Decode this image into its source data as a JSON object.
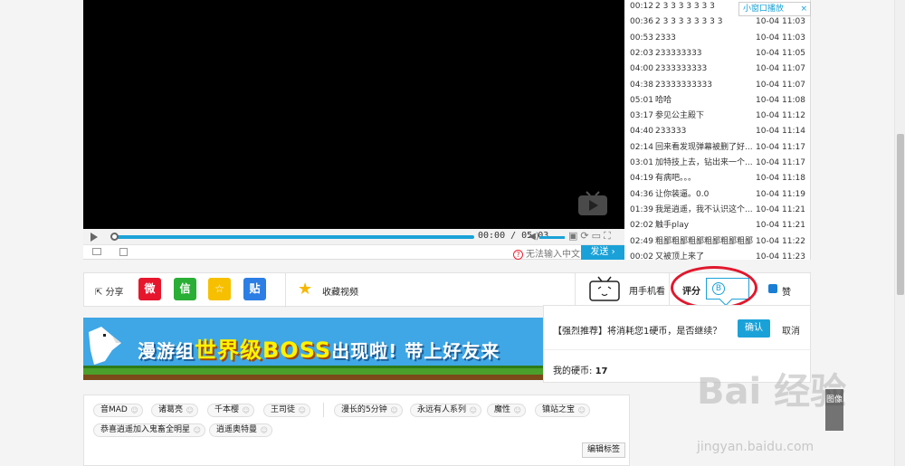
{
  "player": {
    "time_display": "00:00 / 05:03",
    "help_note": "无法输入中文?",
    "send_label": "发送 ›"
  },
  "mini_window": {
    "label": "小窗口播放",
    "close": "×"
  },
  "danmaku": [
    {
      "time": "00:12",
      "content": "2 3 3 3 3 3 3 3",
      "date": "10-04 11:03"
    },
    {
      "time": "00:36",
      "content": "2 3 3 3 3 3 3 3 3",
      "date": "10-04 11:03"
    },
    {
      "time": "00:53",
      "content": "2333",
      "date": "10-04 11:03"
    },
    {
      "time": "02:03",
      "content": "233333333",
      "date": "10-04 11:05"
    },
    {
      "time": "04:00",
      "content": "2333333333",
      "date": "10-04 11:07"
    },
    {
      "time": "04:38",
      "content": "23333333333",
      "date": "10-04 11:07"
    },
    {
      "time": "05:01",
      "content": "哈哈",
      "date": "10-04 11:08"
    },
    {
      "time": "03:17",
      "content": "参见公主殿下",
      "date": "10-04 11:12"
    },
    {
      "time": "04:40",
      "content": "233333",
      "date": "10-04 11:14"
    },
    {
      "time": "02:14",
      "content": "回来看发现弹幕被删了好...",
      "date": "10-04 11:17"
    },
    {
      "time": "03:01",
      "content": "加特技上去，钻出来一个...",
      "date": "10-04 11:17"
    },
    {
      "time": "04:19",
      "content": "有病吧。。。",
      "date": "10-04 11:18"
    },
    {
      "time": "04:36",
      "content": "让你装逼。0.0",
      "date": "10-04 11:19"
    },
    {
      "time": "01:39",
      "content": "我是逍遥，我不认识这个...",
      "date": "10-04 11:21"
    },
    {
      "time": "02:02",
      "content": "触手play",
      "date": "10-04 11:21"
    },
    {
      "time": "02:49",
      "content": "粗鄙粗鄙粗鄙粗鄙粗鄙粗鄙",
      "date": "10-04 11:22"
    },
    {
      "time": "00:02",
      "content": "又被顶上来了",
      "date": "10-04 11:23"
    }
  ],
  "actions": {
    "share": "分享",
    "weibo": "微",
    "wechat": "信",
    "qzone": "☆",
    "tieba": "贴",
    "favorite": "收藏视频",
    "mobile": "用手机看",
    "rate": "评分",
    "coin": "B",
    "like": "赞"
  },
  "banner": {
    "part1": "漫游组",
    "highlight": "世界级BOSS",
    "part2": "出现啦! 带上好友来"
  },
  "popup": {
    "message": "【强烈推荐】将消耗您1硬币，是否继续？",
    "confirm": "确认",
    "cancel": "取消",
    "coins_label": "我的硬币:",
    "coins_value": "17"
  },
  "tags": {
    "items": [
      "音MAD",
      "诸葛亮",
      "千本樱",
      "王司徒",
      "漫长的5分钟",
      "永远有人系列",
      "魔性",
      "镇站之宝",
      "恭喜逍遥加入鬼畜全明星",
      "逍遥奥特曼"
    ],
    "edit": "编辑标签"
  },
  "watermark": {
    "text": "Bai",
    "text2": "经验",
    "url": "jingyan.baidu.com",
    "badge": "图像"
  },
  "colors": {
    "accent": "#1aa2d8",
    "highlight_oval": "#e0182d"
  }
}
